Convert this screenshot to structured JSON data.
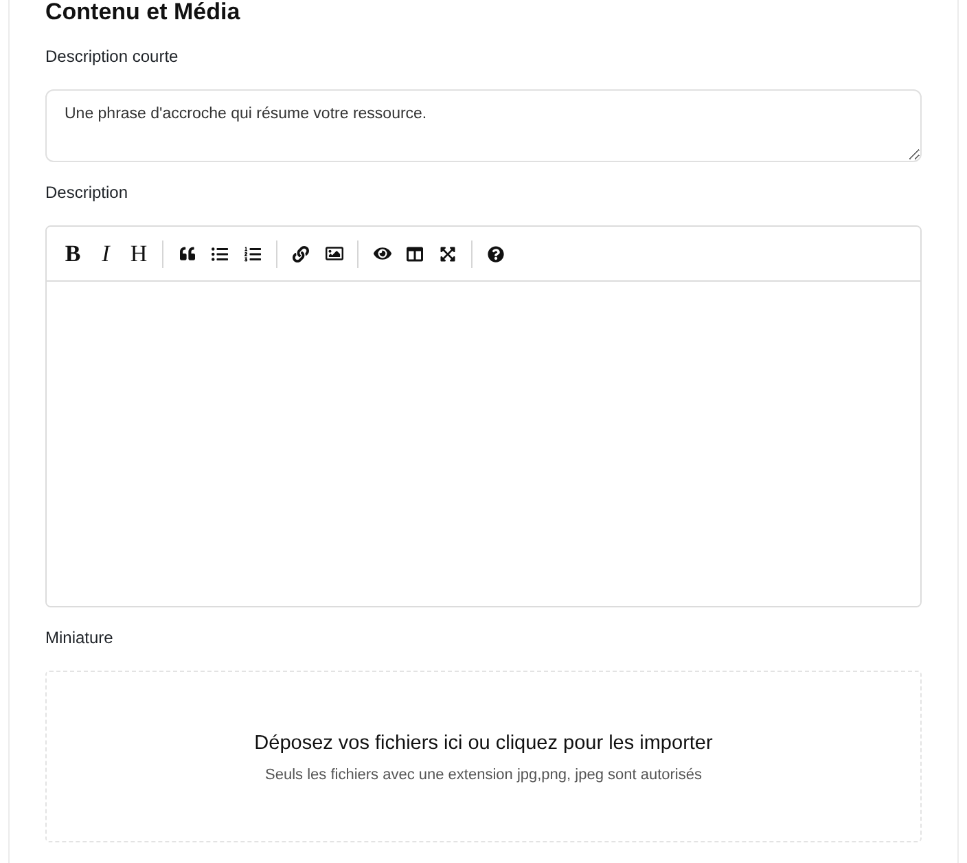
{
  "section": {
    "title": "Contenu et Média"
  },
  "short_description": {
    "label": "Description courte",
    "value": "Une phrase d'accroche qui résume votre ressource."
  },
  "description": {
    "label": "Description",
    "toolbar_text_buttons": [
      {
        "label": "B",
        "kind": "bold"
      },
      {
        "label": "I",
        "kind": "italic"
      },
      {
        "label": "H",
        "kind": "heading"
      }
    ]
  },
  "thumbnail": {
    "label": "Miniature",
    "dropzone_title": "Déposez vos fichiers ici ou cliquez pour les importer",
    "dropzone_hint": "Seuls les fichiers avec une extension jpg,png, jpeg sont autorisés"
  }
}
